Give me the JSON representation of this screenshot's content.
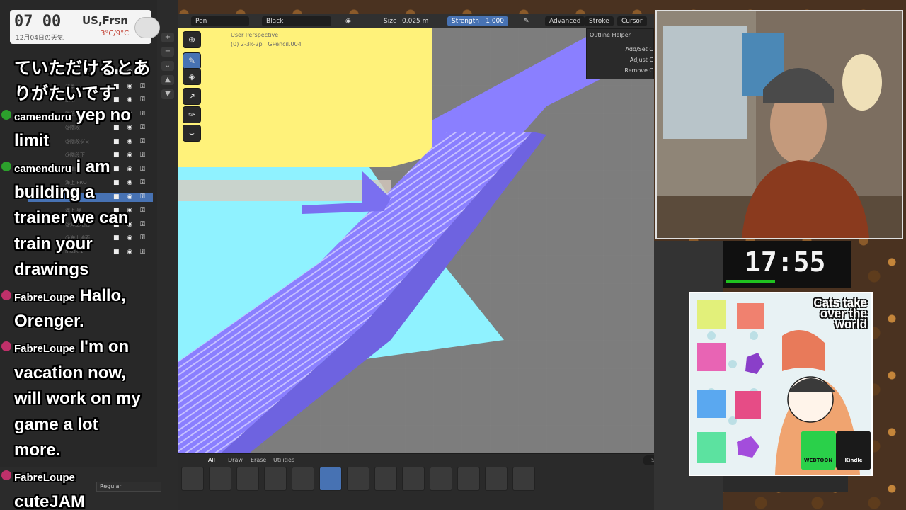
{
  "weather": {
    "time": "07 00",
    "location": "US,Frsn",
    "date": "12月04日の天気",
    "temperature": "3°C/9°C"
  },
  "chat": [
    {
      "kind": "text",
      "text": "ていただけるとあ"
    },
    {
      "kind": "text",
      "text": "りがたいです"
    },
    {
      "kind": "user",
      "user": "camenduru",
      "text": "yep no"
    },
    {
      "kind": "text",
      "text": "limit"
    },
    {
      "kind": "user",
      "user": "camenduru",
      "text": "i am"
    },
    {
      "kind": "text",
      "text": "building a"
    },
    {
      "kind": "text",
      "text": "trainer we can"
    },
    {
      "kind": "text",
      "text": "train your"
    },
    {
      "kind": "text",
      "text": "drawings"
    },
    {
      "kind": "user",
      "user": "FabreLoupe",
      "text": "Hallo,"
    },
    {
      "kind": "text",
      "text": "Orenger."
    },
    {
      "kind": "user",
      "user": "FabreLoupe",
      "text": "I'm on"
    },
    {
      "kind": "text",
      "text": "vacation now,"
    },
    {
      "kind": "text",
      "text": "will work on my"
    },
    {
      "kind": "text",
      "text": "game a lot"
    },
    {
      "kind": "text",
      "text": "more."
    },
    {
      "kind": "user",
      "user": "FabreLoupe",
      "text": ""
    },
    {
      "kind": "text",
      "text": "cuteJAM"
    }
  ],
  "outliner": {
    "rows": [
      "めも",
      "背景",
      "動物",
      "階段.001",
      "@階段",
      "@階段ダミ",
      "@階段下",
      "@階段",
      "海上 FRO",
      "海上 中",
      "海上 奥",
      "@海上地面",
      "@海上地面",
      "mask 1"
    ],
    "selected_index": 9,
    "material_mode": "Regular"
  },
  "header": {
    "tool": "Pen",
    "material": "Black",
    "size_label": "Size",
    "size_value": "0.025 m",
    "strength_label": "Strength",
    "strength_value": "1.000",
    "advanced": "Advanced",
    "stroke": "Stroke",
    "cursor": "Cursor"
  },
  "viewport": {
    "perspective": "User Perspective",
    "object_info": "(0) 2-3k-2p | GPencil.004"
  },
  "outline_helper": {
    "title": "Outline Helper",
    "add_set": "Add/Set C",
    "adjust": "Adjust C",
    "remove": "Remove C"
  },
  "brush_bar": {
    "tabs": [
      "All",
      "Draw",
      "Erase",
      "Utilities"
    ],
    "active_tab": "All",
    "search_placeholder": "Search"
  },
  "timer": {
    "value": "17:55",
    "progress": 0.4
  },
  "ad": {
    "headline": "Cats take over the world",
    "badge_webtoon": "WEBTOON",
    "badge_kindle": "Kindle"
  },
  "colors": {
    "blender_accent": "#4772b3",
    "stairs": "#8a7fff",
    "sea": "#8ff2ff",
    "sky_block": "#fff27a",
    "ground": "#7a7a7a"
  }
}
